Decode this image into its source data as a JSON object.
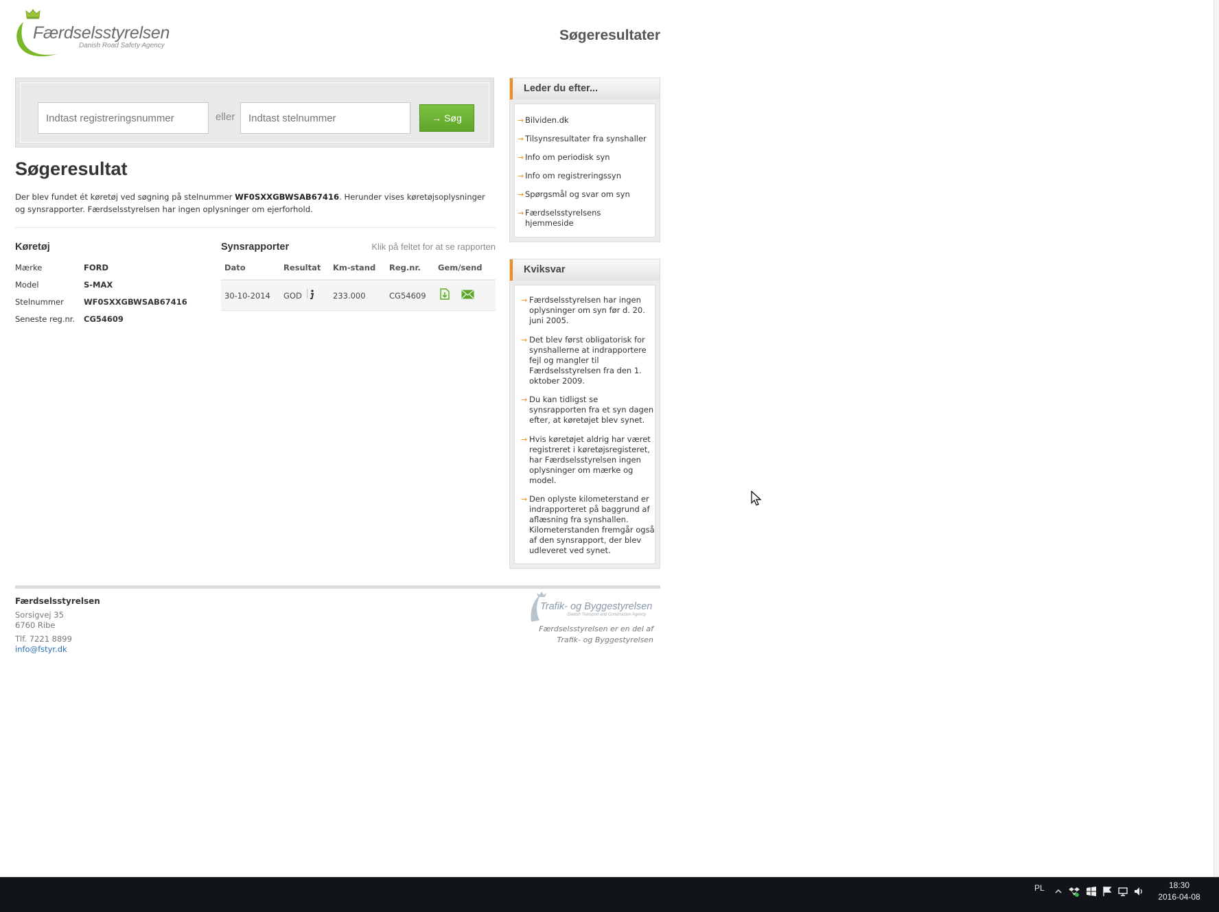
{
  "header": {
    "logo_name": "Færdselsstyrelsen",
    "logo_sub": "Danish Road Safety Agency",
    "page_title": "Søgeresultater"
  },
  "search": {
    "reg_placeholder": "Indtast registreringsnummer",
    "or_label": "eller",
    "stel_placeholder": "Indtast stelnummer",
    "button_label": "→ Søg"
  },
  "result": {
    "title": "Søgeresultat",
    "text_before": "Der blev fundet ét køretøj ved søgning på stelnummer ",
    "vin_highlight": "WF0SXXGBWSAB67416",
    "text_after": ". Herunder vises køretøjsoplysninger og synsrapporter. Færdselsstyrelsen har ingen oplysninger om ejerforhold."
  },
  "vehicle": {
    "title": "Køretøj",
    "rows": [
      {
        "label": "Mærke",
        "value": "FORD"
      },
      {
        "label": "Model",
        "value": "S-MAX"
      },
      {
        "label": "Stelnummer",
        "value": "WF0SXXGBWSAB67416"
      },
      {
        "label": "Seneste reg.nr.",
        "value": "CG54609"
      }
    ]
  },
  "reports": {
    "title": "Synsrapporter",
    "hint": "Klik på feltet for at se rapporten",
    "headers": [
      "Dato",
      "Resultat",
      "Km-stand",
      "Reg.nr.",
      "Gem/send"
    ],
    "rows": [
      {
        "date": "30-10-2014",
        "result": "GOD",
        "km": "233.000",
        "reg": "CG54609"
      }
    ]
  },
  "sidebar": {
    "looking_for": {
      "title": "Leder du efter...",
      "links": [
        "Bilviden.dk",
        "Tilsynsresultater fra synshaller",
        "Info om periodisk syn",
        "Info om registreringssyn",
        "Spørgsmål og svar om syn",
        "Færdselsstyrelsens hjemmeside"
      ]
    },
    "quick": {
      "title": "Kviksvar",
      "items": [
        "Færdselsstyrelsen har ingen oplysninger om syn før d. 20. juni 2005.",
        "Det blev først obligatorisk for synshallerne at indrapportere fejl og mangler til Færdselsstyrelsen fra den 1. oktober 2009.",
        "Du kan tidligst se synsrapporten fra et syn dagen efter, at køretøjet blev synet.",
        "Hvis køretøjet aldrig har været registreret i køretøjsregisteret, har Færdselsstyrelsen ingen oplysninger om mærke og model.",
        "Den oplyste kilometerstand er indrapporteret på baggrund af aflæsning fra synshallen. Kilometerstanden fremgår også af den synsrapport, der blev udleveret ved synet."
      ]
    }
  },
  "footer": {
    "name": "Færdselsstyrelsen",
    "address1": "Sorsigvej 35",
    "address2": "6760 Ribe",
    "phone": "Tlf. 7221 8899",
    "email": "info@fstyr.dk",
    "partner_name": "Trafik- og Byggestyrelsen",
    "partner_sub": "Danish Transport and Construction Agency",
    "partner_text1": "Færdselsstyrelsen er en del af",
    "partner_text2": "Trafik- og Byggestyrelsen"
  },
  "taskbar": {
    "lang": "PL",
    "time": "18:30",
    "date": "2016-04-08"
  },
  "colors": {
    "accent_green": "#6db33f",
    "accent_orange": "#f08b1d",
    "link_blue": "#2a6fb6"
  },
  "icons": [
    "crown-icon",
    "save-report-icon",
    "mail-icon",
    "info-icon",
    "arrow-right-icon",
    "mouse-cursor-icon"
  ]
}
